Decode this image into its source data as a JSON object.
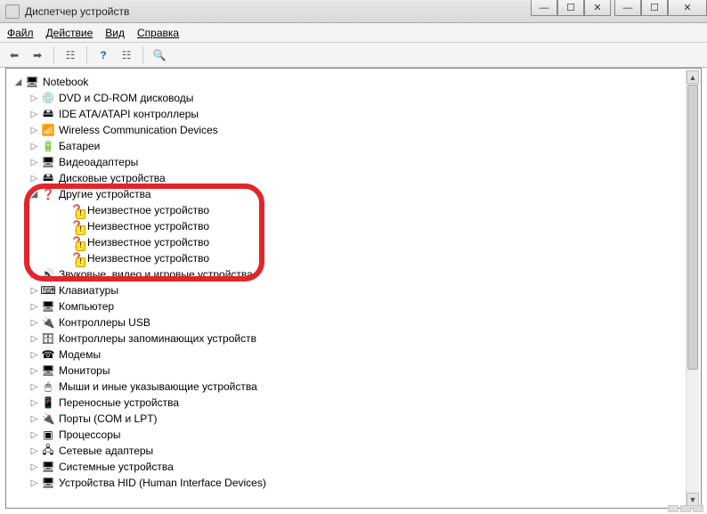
{
  "window": {
    "title": "Диспетчер устройств"
  },
  "menu": {
    "file": "Файл",
    "action": "Действие",
    "view": "Вид",
    "help": "Справка"
  },
  "tree": {
    "root": "Notebook",
    "children": [
      {
        "icon": "💿",
        "label": "DVD и CD-ROM дисководы"
      },
      {
        "icon": "🖴",
        "label": "IDE ATA/ATAPI контроллеры"
      },
      {
        "icon": "📶",
        "label": "Wireless Communication Devices"
      },
      {
        "icon": "🔋",
        "label": "Батареи"
      },
      {
        "icon": "🖥",
        "label": "Видеоадаптеры"
      },
      {
        "icon": "🖴",
        "label": "Дисковые устройства"
      },
      {
        "expanded": true,
        "icon": "❓",
        "label": "Другие устройства",
        "children": [
          {
            "icon": "❓",
            "warn": true,
            "label": "Неизвестное устройство"
          },
          {
            "icon": "❓",
            "warn": true,
            "label": "Неизвестное устройство"
          },
          {
            "icon": "❓",
            "warn": true,
            "label": "Неизвестное устройство"
          },
          {
            "icon": "❓",
            "warn": true,
            "label": "Неизвестное устройство"
          }
        ]
      },
      {
        "icon": "🔊",
        "label": "Звуковые, видео и игровые устройства"
      },
      {
        "icon": "⌨",
        "label": "Клавиатуры"
      },
      {
        "icon": "🖥",
        "label": "Компьютер"
      },
      {
        "icon": "🔌",
        "label": "Контроллеры USB"
      },
      {
        "icon": "🗄",
        "label": "Контроллеры запоминающих устройств"
      },
      {
        "icon": "☎",
        "label": "Модемы"
      },
      {
        "icon": "🖥",
        "label": "Мониторы"
      },
      {
        "icon": "🖱",
        "label": "Мыши и иные указывающие устройства"
      },
      {
        "icon": "📱",
        "label": "Переносные устройства"
      },
      {
        "icon": "🔌",
        "label": "Порты (COM и LPT)"
      },
      {
        "icon": "▣",
        "label": "Процессоры"
      },
      {
        "icon": "🖧",
        "label": "Сетевые адаптеры"
      },
      {
        "icon": "🖥",
        "label": "Системные устройства"
      },
      {
        "icon": "🖥",
        "label": "Устройства HID (Human Interface Devices)"
      }
    ]
  },
  "toolbarIcons": [
    "back",
    "forward",
    "sep",
    "props",
    "sep",
    "help",
    "show",
    "sep",
    "scan"
  ]
}
